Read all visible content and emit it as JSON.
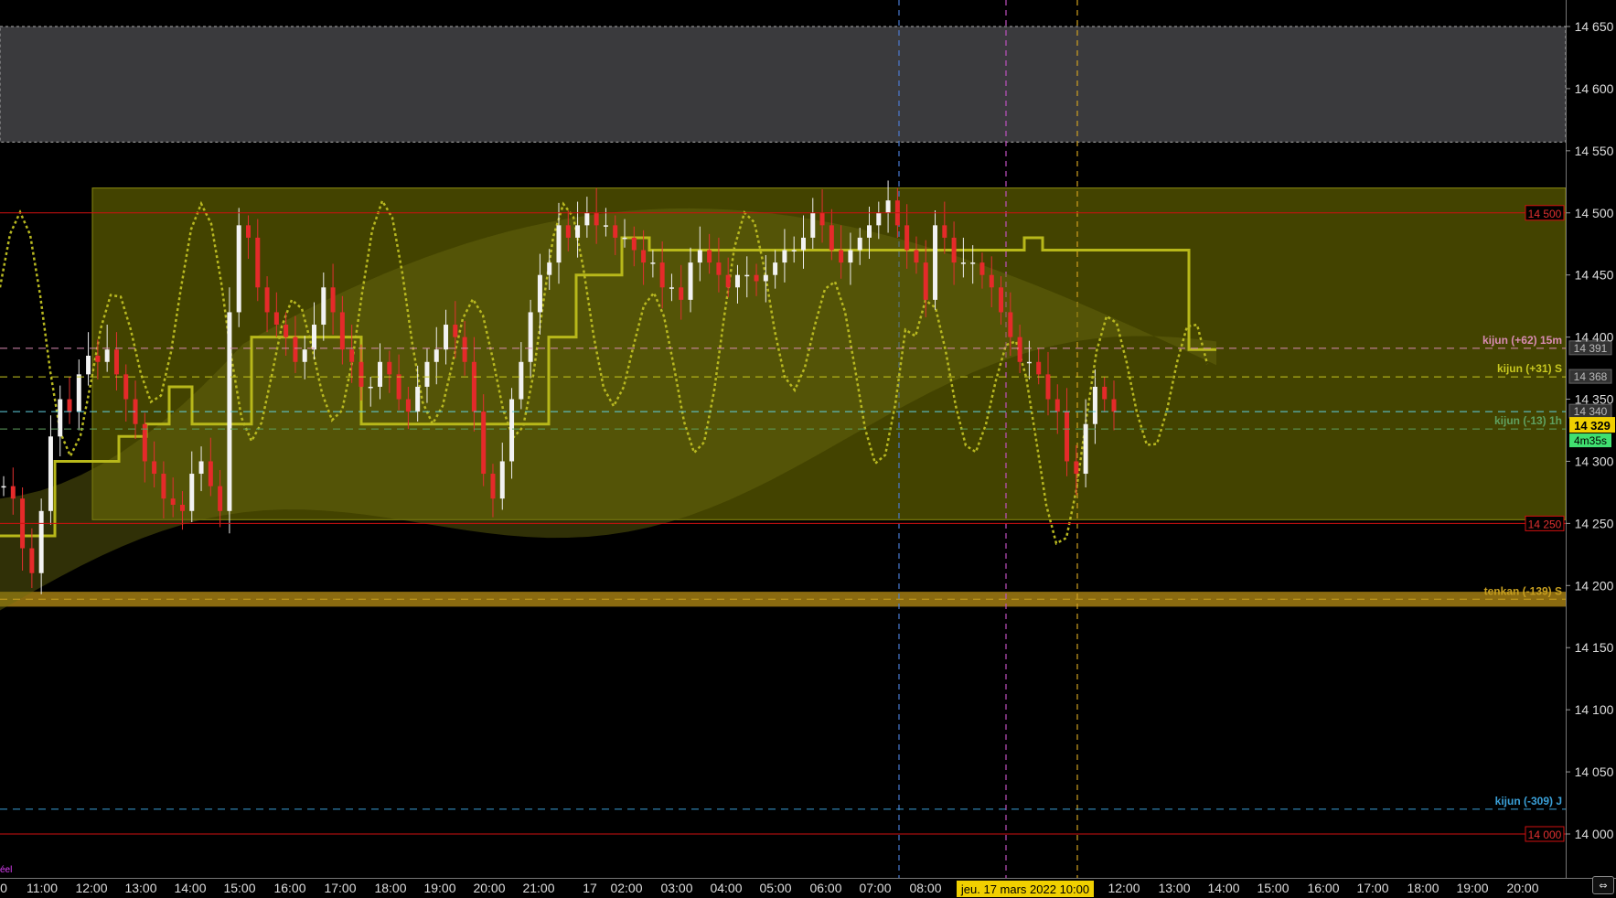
{
  "chart_data": {
    "type": "candlestick",
    "instrument_note": "",
    "y_axis": {
      "min": 13960,
      "max": 14670,
      "ticks": [
        14000,
        14050,
        14100,
        14150,
        14200,
        14250,
        14300,
        14350,
        14400,
        14450,
        14500,
        14550,
        14600,
        14650
      ],
      "tick_labels": [
        "14 000",
        "14 050",
        "14 100",
        "14 150",
        "14 200",
        "14 250",
        "14 300",
        "14 350",
        "14 400",
        "14 450",
        "14 500",
        "14 550",
        "14 600",
        "14 650"
      ]
    },
    "x_axis": {
      "labels": [
        "0",
        "11:00",
        "12:00",
        "13:00",
        "14:00",
        "15:00",
        "16:00",
        "17:00",
        "18:00",
        "19:00",
        "20:00",
        "21:00",
        "17",
        "02:00",
        "03:00",
        "04:00",
        "05:00",
        "06:00",
        "07:00",
        "08:00",
        "12:00",
        "13:00",
        "14:00",
        "15:00",
        "16:00",
        "17:00",
        "18:00",
        "19:00",
        "20:00"
      ],
      "highlight_label": "jeu. 17 mars 2022 10:00"
    },
    "zones": [
      {
        "name": "grey-zone",
        "from": 14557,
        "to": 14650,
        "color": "#3a3a3d"
      },
      {
        "name": "range-box",
        "from": 14253,
        "to": 14520,
        "color": "#4f4f00"
      },
      {
        "name": "orange-band",
        "from": 14183,
        "to": 14195,
        "color": "#8a6a10"
      }
    ],
    "levels": [
      {
        "value": 14500,
        "label": "14 500",
        "kind": "red-line",
        "color": "#d01010"
      },
      {
        "value": 14250,
        "label": "14 250",
        "kind": "red-line",
        "color": "#d01010"
      },
      {
        "value": 14000,
        "label": "14 000",
        "kind": "red-line",
        "color": "#d01010"
      },
      {
        "value": 14391,
        "label": "kijun (+62) 15m",
        "price": "14 391",
        "kind": "dashed",
        "color": "#d98cb3"
      },
      {
        "value": 14368,
        "label": "kijun (+31) S",
        "price": "14 368",
        "kind": "dashed",
        "color": "#c8c820"
      },
      {
        "value": 14340,
        "label": "",
        "price": "14 340",
        "kind": "dashed",
        "color": "#60d0e0"
      },
      {
        "value": 14326,
        "label": "kijun (-13) 1h",
        "price": "",
        "kind": "dashed",
        "color": "#5fa05f"
      },
      {
        "value": 14189,
        "label": "tenkan (-139) S",
        "price": "",
        "kind": "dashed",
        "color": "#c8a020"
      },
      {
        "value": 14020,
        "label": "kijun (-309) J",
        "price": "",
        "kind": "dashed",
        "color": "#3aa0d8"
      }
    ],
    "current_price": {
      "value": 14329,
      "label": "14 329",
      "countdown": "4m35s"
    },
    "vertical_markers": [
      {
        "x_label": "07:30",
        "color": "#4a7ad0"
      },
      {
        "x_label": "09:40",
        "color": "#c050c0"
      },
      {
        "x_label": "10:00",
        "color": "#d0a020"
      }
    ],
    "close_series_note": "approximate path of closes",
    "closes": [
      14280,
      14270,
      14230,
      14210,
      14260,
      14320,
      14350,
      14340,
      14370,
      14385,
      14380,
      14390,
      14370,
      14350,
      14330,
      14300,
      14290,
      14270,
      14265,
      14260,
      14290,
      14300,
      14280,
      14260,
      14420,
      14490,
      14480,
      14440,
      14420,
      14410,
      14400,
      14380,
      14390,
      14410,
      14440,
      14420,
      14390,
      14380,
      14360,
      14360,
      14380,
      14370,
      14350,
      14340,
      14360,
      14380,
      14390,
      14410,
      14400,
      14380,
      14340,
      14290,
      14270,
      14300,
      14350,
      14380,
      14420,
      14450,
      14460,
      14490,
      14480,
      14490,
      14500,
      14490,
      14490,
      14480,
      14480,
      14470,
      14460,
      14460,
      14440,
      14440,
      14430,
      14460,
      14470,
      14460,
      14450,
      14440,
      14450,
      14450,
      14445,
      14450,
      14460,
      14470,
      14470,
      14480,
      14500,
      14490,
      14470,
      14460,
      14470,
      14480,
      14490,
      14500,
      14510,
      14490,
      14470,
      14460,
      14430,
      14490,
      14480,
      14460,
      14460,
      14460,
      14450,
      14440,
      14420,
      14400,
      14380,
      14380,
      14370,
      14350,
      14340,
      14300,
      14290,
      14330,
      14360,
      14350,
      14340
    ]
  },
  "ui": {
    "corner_text": "éel",
    "scroll_button_icon": "⇔"
  }
}
